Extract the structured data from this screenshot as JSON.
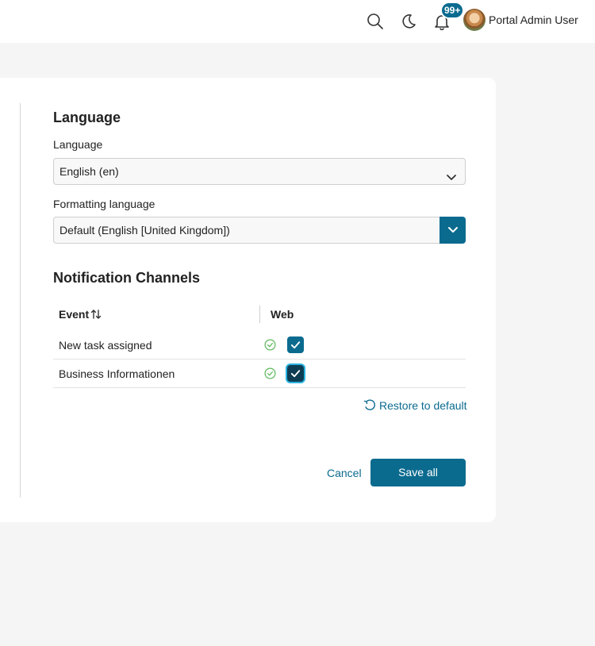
{
  "header": {
    "notifications_badge": "99+",
    "user_name": "Portal Admin User",
    "icons": [
      "search-icon",
      "moon-icon",
      "bell-icon"
    ]
  },
  "language_section": {
    "title": "Language",
    "language_label": "Language",
    "language_value": "English (en)",
    "formatting_label": "Formatting language",
    "formatting_value": "Default (English [United Kingdom])"
  },
  "notifications_section": {
    "title": "Notification Channels",
    "columns": {
      "event": "Event",
      "web": "Web"
    },
    "rows": [
      {
        "event": "New task assigned",
        "web_checked": true
      },
      {
        "event": "Business Informationen",
        "web_checked": true
      }
    ],
    "restore_label": "Restore to default"
  },
  "actions": {
    "cancel_label": "Cancel",
    "save_label": "Save all"
  },
  "colors": {
    "accent": "#0b6b8f",
    "success": "#5cb85c",
    "background": "#f5f5f5"
  }
}
